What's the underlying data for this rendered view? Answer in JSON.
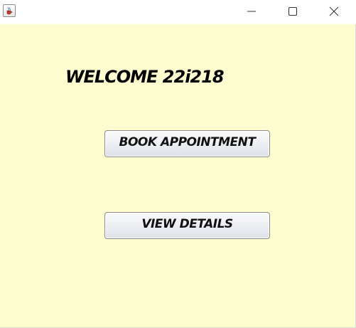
{
  "window": {
    "icon": "java-cup-icon",
    "controls": [
      "minimize-icon",
      "maximize-icon",
      "close-icon"
    ]
  },
  "main": {
    "welcome_text": "WELCOME 22i218",
    "book_appointment_label": "BOOK APPOINTMENT",
    "view_details_label": "VIEW DETAILS"
  },
  "colors": {
    "background": "#fefed0",
    "titlebar": "#ffffff",
    "button_border": "#8a8a8a"
  }
}
